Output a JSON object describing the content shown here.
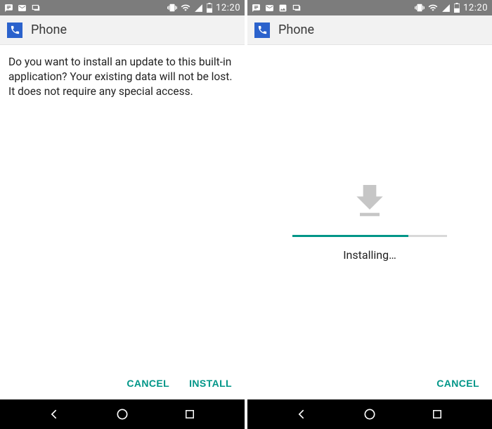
{
  "status": {
    "time": "12:20"
  },
  "app": {
    "title": "Phone"
  },
  "left": {
    "prompt": "Do you want to install an update to this built-in application? Your existing data will not be lost. It does not require any special access.",
    "cancel_label": "CANCEL",
    "install_label": "INSTALL"
  },
  "right": {
    "progress_label": "Installing…",
    "progress_percent": 75,
    "cancel_label": "CANCEL"
  },
  "colors": {
    "accent": "#009688",
    "app_icon_bg": "#2b62cc"
  }
}
